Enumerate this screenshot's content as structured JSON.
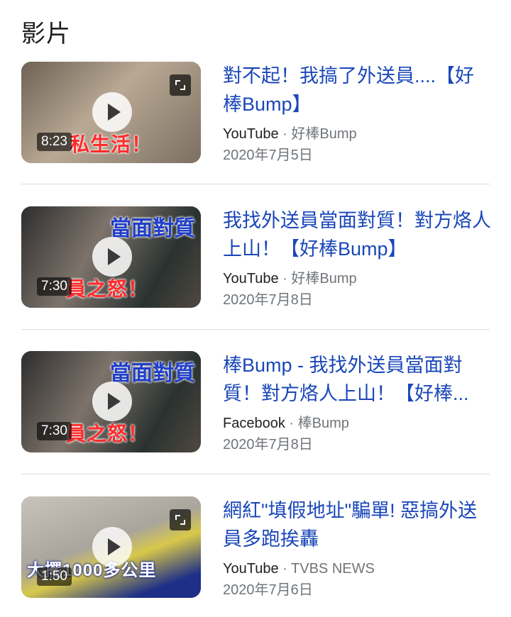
{
  "section": {
    "title": "影片"
  },
  "videos": [
    {
      "title": "對不起！我搞了外送員....【好棒Bump】",
      "source": "YouTube",
      "channel": "好棒Bump",
      "date": "2020年7月5日",
      "duration": "8:23",
      "thumb_caption": "私生活！",
      "thumb_caption_top": "",
      "thumb_colors": [
        "#8a7a6a",
        "#c9b8a4"
      ]
    },
    {
      "title": "我找外送員當面對質！對方烙人上山！【好棒Bump】",
      "source": "YouTube",
      "channel": "好棒Bump",
      "date": "2020年7月8日",
      "duration": "7:30",
      "thumb_caption": "員之怒！",
      "thumb_caption_top": "當面對質",
      "thumb_colors": [
        "#3c3c3c",
        "#9a8f86"
      ]
    },
    {
      "title": "棒Bump - 我找外送員當面對質！對方烙人上山！【好棒...",
      "source": "Facebook",
      "channel": "棒Bump",
      "date": "2020年7月8日",
      "duration": "7:30",
      "thumb_caption": "員之怒！",
      "thumb_caption_top": "當面對質",
      "thumb_colors": [
        "#3c3c3c",
        "#9a8f86"
      ]
    },
    {
      "title": "網紅\"填假地址\"騙單! 惡搞外送員多跑挨轟",
      "source": "YouTube",
      "channel": "TVBS NEWS",
      "date": "2020年7月6日",
      "duration": "1:50",
      "thumb_caption": "大擺1000多公里",
      "thumb_caption_top": "",
      "thumb_colors": [
        "#b7b3aa",
        "#e7d25b"
      ]
    }
  ],
  "separator": "·"
}
